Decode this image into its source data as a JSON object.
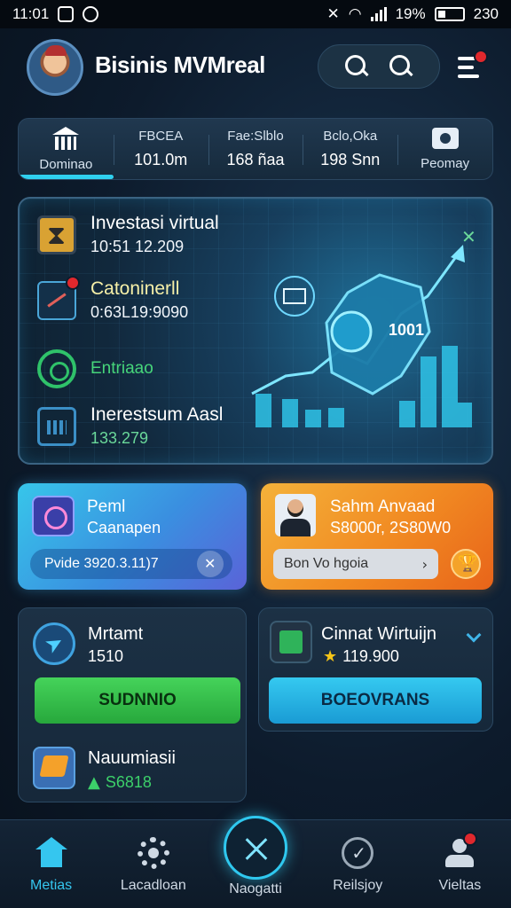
{
  "status": {
    "time": "11:01",
    "battery": "19%",
    "right_time": "230"
  },
  "header": {
    "title": "Bisinis MVMreal"
  },
  "tabs": [
    {
      "label": "Dominao",
      "value": ""
    },
    {
      "label": "FBCEA",
      "value": "101.0m"
    },
    {
      "label": "Fae:Slblo",
      "value": "168 ñaa"
    },
    {
      "label": "Bclo,Oka",
      "value": "198 Snn"
    },
    {
      "label": "Peomay",
      "value": ""
    }
  ],
  "hero": {
    "items": [
      {
        "title": "Investasi virtual",
        "sub": "10:51 12.209"
      },
      {
        "title": "Catoninerll",
        "sub": "0:63L19:9090"
      },
      {
        "title": "Entriaao",
        "sub": ""
      },
      {
        "title": "Inerestsum Aasl",
        "sub": "133.279"
      }
    ],
    "badge": "1001"
  },
  "promo_left": {
    "title": "Peml",
    "sub": "Caanapen",
    "pill": "Pvide 3920.3.11)7"
  },
  "promo_right": {
    "title": "Sahm Anvaad",
    "sub": "S8000r, 2S80W0",
    "pill": "Bon Vo hgoia"
  },
  "card_left": {
    "item1": {
      "title": "Mrtamt",
      "value": "1510"
    },
    "button": "SUDNNIO",
    "item2": {
      "title": "Nauumiasii",
      "value": "S6818"
    }
  },
  "card_right": {
    "title": "Cinnat Wirtuijn",
    "value": "119.900",
    "button": "BOEOVRANS"
  },
  "bottom_nav": [
    {
      "label": "Metias"
    },
    {
      "label": "Lacadloan"
    },
    {
      "label": "Naogatti"
    },
    {
      "label": "Reilsjoy"
    },
    {
      "label": "Vieltas"
    }
  ],
  "colors": {
    "accent": "#2fd0ee",
    "green_button": "#45d35a",
    "orange_card": "#f18a22",
    "blue_card": "#3a8fe0"
  }
}
